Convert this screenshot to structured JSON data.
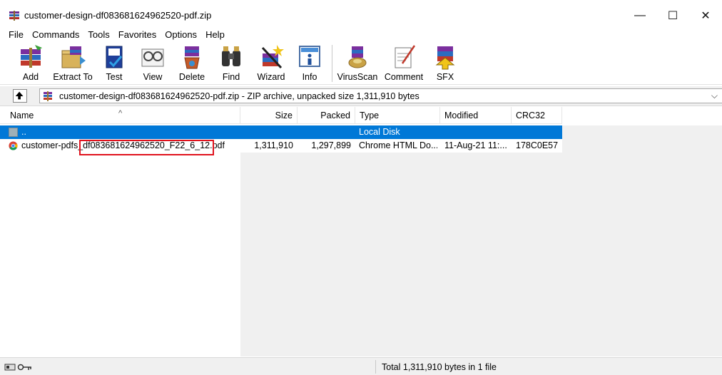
{
  "window": {
    "title": "customer-design-df083681624962520-pdf.zip",
    "minimize": "—",
    "maximize": "☐",
    "close": "✕"
  },
  "menu": [
    "File",
    "Commands",
    "Tools",
    "Favorites",
    "Options",
    "Help"
  ],
  "toolbar": {
    "buttons": [
      {
        "label": "Add",
        "icon": "add-archive-icon"
      },
      {
        "label": "Extract To",
        "icon": "extract-to-icon"
      },
      {
        "label": "Test",
        "icon": "test-icon"
      },
      {
        "label": "View",
        "icon": "view-icon"
      },
      {
        "label": "Delete",
        "icon": "delete-icon"
      },
      {
        "label": "Find",
        "icon": "find-icon"
      },
      {
        "label": "Wizard",
        "icon": "wizard-icon"
      },
      {
        "label": "Info",
        "icon": "info-icon"
      },
      {
        "label": "VirusScan",
        "icon": "virusscan-icon"
      },
      {
        "label": "Comment",
        "icon": "comment-icon"
      },
      {
        "label": "SFX",
        "icon": "sfx-icon"
      }
    ]
  },
  "address": {
    "text": "customer-design-df083681624962520-pdf.zip - ZIP archive, unpacked size 1,311,910 bytes",
    "dropdown": "⌵"
  },
  "columns": {
    "name": "Name",
    "size": "Size",
    "packed": "Packed",
    "type": "Type",
    "modified": "Modified",
    "crc": "CRC32",
    "sort_arrow": "^"
  },
  "rows": [
    {
      "name": "..",
      "size": "",
      "packed": "",
      "type": "Local Disk",
      "modified": "",
      "crc": ""
    },
    {
      "name": "customer-pdfs_df083681624962520_F22_6_12.pdf",
      "size": "1,311,910",
      "packed": "1,297,899",
      "type": "Chrome HTML Do...",
      "modified": "11-Aug-21 11:...",
      "crc": "178C0E57"
    }
  ],
  "status": {
    "text": "Total 1,311,910 bytes in 1 file"
  },
  "colors": {
    "selection": "#0078d7",
    "highlight_box": "#e0121d"
  }
}
